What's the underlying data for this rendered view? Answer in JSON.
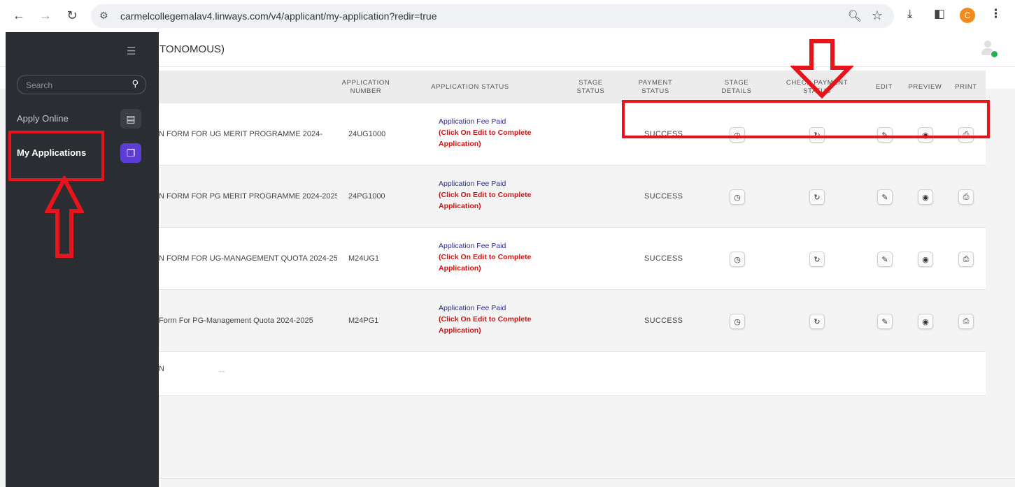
{
  "browser": {
    "url": "carmelcollegemalav4.linways.com/v4/applicant/my-application?redir=true",
    "profile_initial": "C"
  },
  "header": {
    "college_title": "TONOMOUS)"
  },
  "sidebar": {
    "search_placeholder": "Search",
    "items": [
      {
        "label": "Apply Online"
      },
      {
        "label": "My Applications"
      }
    ]
  },
  "table": {
    "headers": {
      "application_number": "APPLICATION NUMBER",
      "application_status": "APPLICATION STATUS",
      "stage_status": "STAGE STATUS",
      "payment_status": "PAYMENT STATUS",
      "stage_details": "STAGE DETAILS",
      "check_payment_status": "CHECK PAYMENT STATUS",
      "edit": "EDIT",
      "preview": "PREVIEW",
      "print": "PRINT"
    },
    "rows": [
      {
        "name": "N FORM FOR UG MERIT PROGRAMME 2024-",
        "number": "24UG1000",
        "status_line1": "Application Fee Paid",
        "status_line2": "(Click On Edit to Complete",
        "status_line3": "Application)",
        "payment": "SUCCESS"
      },
      {
        "name": "N FORM FOR PG MERIT PROGRAMME 2024-2025",
        "number": "24PG1000",
        "status_line1": "Application Fee Paid",
        "status_line2": "(Click On Edit to Complete",
        "status_line3": "Application)",
        "payment": "SUCCESS"
      },
      {
        "name": "N FORM FOR UG-MANAGEMENT QUOTA 2024-25",
        "number": "M24UG1",
        "status_line1": "Application Fee Paid",
        "status_line2": "(Click On Edit to Complete",
        "status_line3": "Application)",
        "payment": "SUCCESS"
      },
      {
        "name": "Form For PG-Management Quota 2024-2025",
        "number": "M24PG1",
        "status_line1": "Application Fee Paid",
        "status_line2": "(Click On Edit to Complete",
        "status_line3": "Application)",
        "payment": "SUCCESS"
      }
    ],
    "partial_row": {
      "name": "N",
      "extra": "..."
    }
  },
  "colors": {
    "sidebar_bg": "#2a2e33",
    "accent_purple": "#5c3dd6",
    "annotation_red": "#e8141b",
    "status_blue": "#2e2e8a",
    "status_red": "#d01515"
  }
}
